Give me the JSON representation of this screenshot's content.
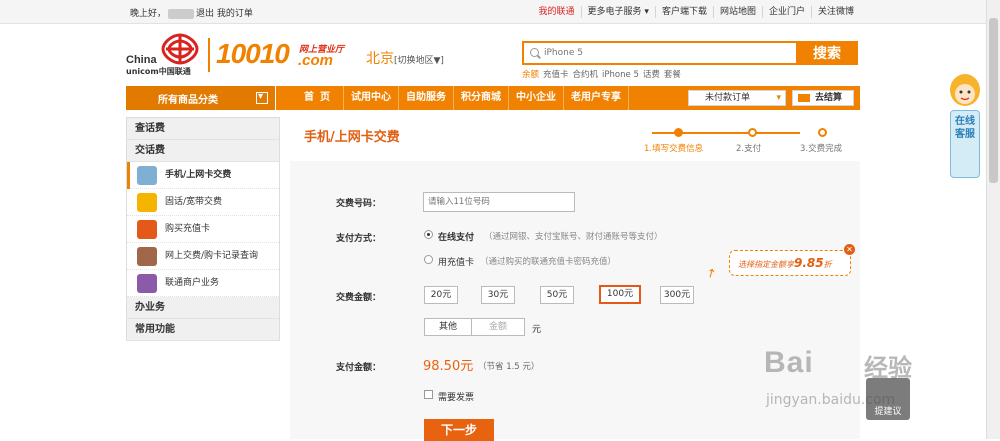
{
  "topbar": {
    "greeting": "晚上好，",
    "logout": "退出",
    "my_orders": "我的订单",
    "links": [
      "我的联通",
      "更多电子服务 ▾",
      "客户端下载",
      "网站地图",
      "企业门户",
      "关注微博"
    ]
  },
  "header": {
    "logo_cn": "China",
    "logo_en": "unicom中国联通",
    "number": "10010",
    "biz": "网上营业厅",
    "domain": ".com",
    "city": "北京",
    "switch": "[切换地区▼]"
  },
  "search": {
    "placeholder": "iPhone 5",
    "button": "搜索",
    "hot": [
      "余额",
      "充值卡",
      "合约机",
      "iPhone 5",
      "话费",
      "套餐"
    ]
  },
  "nav": {
    "all_categories": "所有商品分类",
    "items": [
      "首页",
      "试用中心",
      "自助服务",
      "积分商城",
      "中小企业",
      "老用户专享"
    ],
    "unpaid": "未付款订单",
    "checkout": "去结算"
  },
  "sidebar": {
    "cat1": "查话费",
    "cat2": "交话费",
    "items": [
      "手机/上网卡交费",
      "固话/宽带交费",
      "购买充值卡",
      "网上交费/购卡记录查询",
      "联通商户业务"
    ],
    "cat3": "办业务",
    "cat4": "常用功能"
  },
  "main": {
    "title": "手机/上网卡交费",
    "steps": [
      "1.填写交费信息",
      "2.支付",
      "3.交费完成"
    ],
    "phone_label": "交费号码：",
    "phone_placeholder": "请输入11位号码",
    "pay_method_label": "支付方式：",
    "online_pay": "在线支付",
    "online_desc": "（通过网银、支付宝账号、财付通账号等支付）",
    "card_pay": "用充值卡",
    "card_desc": "（通过购买的联通充值卡密码充值）",
    "amount_label": "交费金额：",
    "amounts": [
      "20元",
      "30元",
      "50元",
      "100元",
      "300元"
    ],
    "selected_amount": "100元",
    "other": "其他",
    "custom_placeholder": "金额",
    "unit": "元",
    "tip_prefix": "选择指定金额享",
    "tip_value": "9.85",
    "tip_suffix": "折",
    "pay_amount_label": "支付金额：",
    "pay_amount": "98.50元",
    "savings": "（节省 1.5 元）",
    "invoice": "需要发票",
    "submit": "下一步"
  },
  "customer_service": "在线客服",
  "watermark": {
    "brand": "Bai",
    "jy": "经验",
    "url": "jingyan.baidu.com"
  },
  "suggest": "提建议",
  "colors": {
    "accent": "#f18101",
    "red": "#d9231f"
  }
}
